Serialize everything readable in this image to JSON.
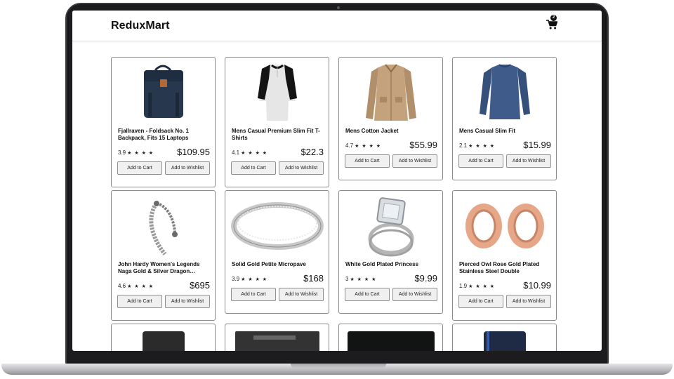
{
  "app": {
    "brand": "ReduxMart"
  },
  "cart": {
    "count": "2"
  },
  "buttons": {
    "add_to_cart": "Add to Cart",
    "add_to_wishlist": "Add to Wishlist"
  },
  "products": [
    {
      "title": "Fjallraven - Foldsack No. 1 Backpack, Fits 15 Laptops",
      "rating": "3.9",
      "stars": "★ ★ ★ ★",
      "price": "$109.95",
      "image": "backpack"
    },
    {
      "title": "Mens Casual Premium Slim Fit T-Shirts",
      "rating": "4.1",
      "stars": "★ ★ ★ ★",
      "price": "$22.3",
      "image": "raglan-tshirt"
    },
    {
      "title": "Mens Cotton Jacket",
      "rating": "4.7",
      "stars": "★ ★ ★ ★",
      "price": "$55.99",
      "image": "cotton-jacket"
    },
    {
      "title": "Mens Casual Slim Fit",
      "rating": "2.1",
      "stars": "★ ★ ★ ★",
      "price": "$15.99",
      "image": "long-sleeve-shirt"
    },
    {
      "title": "John Hardy Women's Legends Naga Gold & Silver Dragon…",
      "rating": "4.6",
      "stars": "★ ★ ★ ★",
      "price": "$695",
      "image": "dragon-bracelet"
    },
    {
      "title": "Solid Gold Petite Micropave",
      "rating": "3.9",
      "stars": "★ ★ ★ ★",
      "price": "$168",
      "image": "micropave-ring"
    },
    {
      "title": "White Gold Plated Princess",
      "rating": "3",
      "stars": "★ ★ ★ ★",
      "price": "$9.99",
      "image": "princess-ring"
    },
    {
      "title": "Pierced Owl Rose Gold Plated Stainless Steel Double",
      "rating": "1.9",
      "stars": "★ ★ ★ ★",
      "price": "$10.99",
      "image": "rose-gold-plugs"
    }
  ],
  "partial_row_images": [
    "hard-drive",
    "ssd",
    "monitor",
    "hard-drive-blue"
  ]
}
